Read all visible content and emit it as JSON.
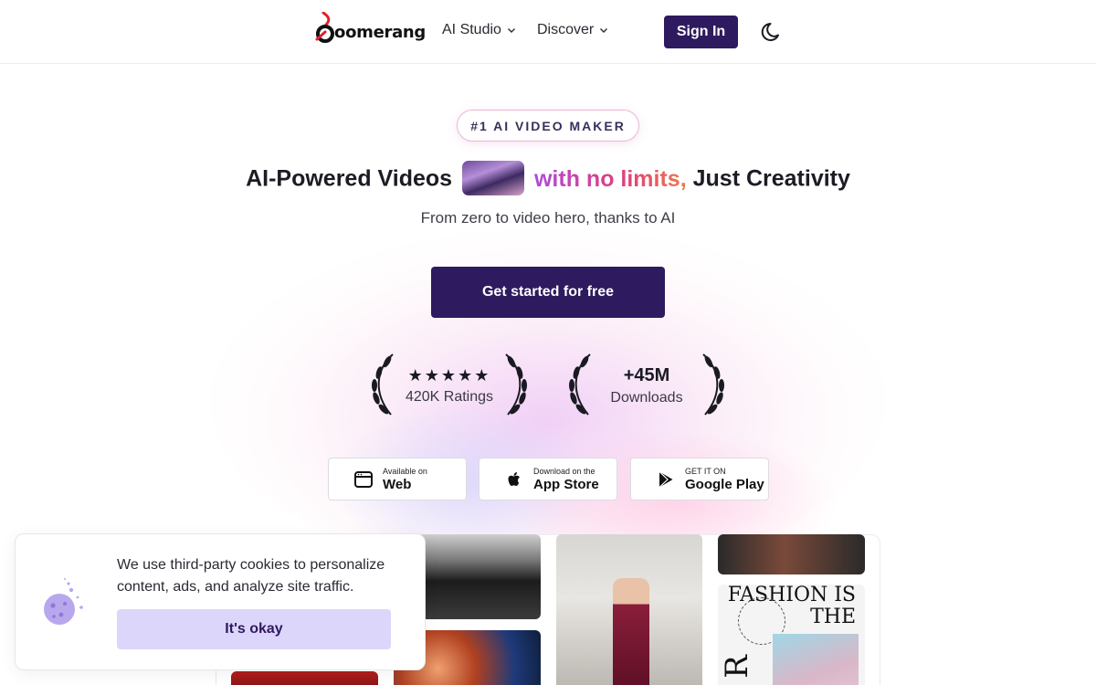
{
  "header": {
    "logo_text": "oomerang",
    "nav": [
      {
        "label": "AI Studio"
      },
      {
        "label": "Discover"
      }
    ],
    "signin_label": "Sign In",
    "theme_icon": "moon-icon"
  },
  "hero": {
    "badge": "#1 AI VIDEO MAKER",
    "headline_start": "AI-Powered Videos",
    "headline_highlight": "with no limits,",
    "headline_end": "Just Creativity",
    "subtitle": "From zero to video hero, thanks to AI",
    "cta_label": "Get started for free",
    "accent_color": "#2e1a5e",
    "highlight_gradient": [
      "#b04ad8",
      "#e0407a",
      "#ee7a4a"
    ]
  },
  "stats": [
    {
      "top": "★★★★★",
      "bottom": "420K Ratings"
    },
    {
      "top": "+45M",
      "bottom": "Downloads"
    }
  ],
  "stores": [
    {
      "small": "Available on",
      "large": "Web",
      "icon": "browser-window-icon"
    },
    {
      "small": "Download on the",
      "large": "App Store",
      "icon": "apple-icon"
    },
    {
      "small": "GET IT ON",
      "large": "Google Play",
      "icon": "google-play-icon"
    }
  ],
  "gallery": {
    "poster_text": "FASHION IS THE",
    "poster_letter": "R"
  },
  "cookie": {
    "text": "We use third-party cookies to personalize content, ads, and analyze site traffic.",
    "button_label": "It's okay",
    "button_color": "#ddd6fb",
    "icon": "cookie-icon"
  }
}
